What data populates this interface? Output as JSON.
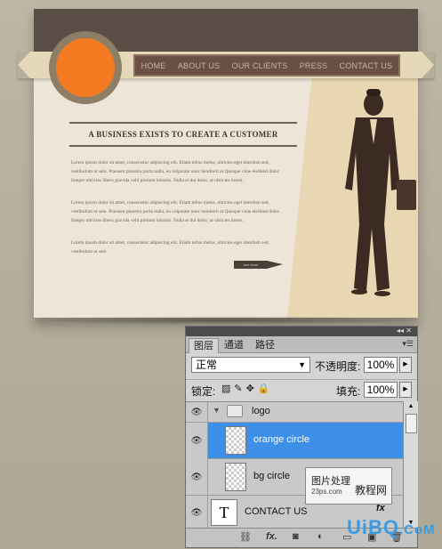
{
  "site": {
    "nav": [
      "HOME",
      "ABOUT US",
      "OUR CLIENTS",
      "PRESS",
      "CONTACT US"
    ],
    "headline": "A BUSINESS EXISTS TO CREATE A CUSTOMER",
    "paragraphs": [
      "Lorem ipsum dolor sit amet, consectetur adipiscing elit. Etiam tellus metus, ultricies eget interdum sed, vestibulum ut sem. Praesent pharetra porta nulla, eu vulputate nunc hendrerit at Quisque vitae eleifend dolor. Integer ultricies libero gravida velit pretium lobortis. Nulla et dui dolor, ut ultricies lorem.",
      "Lorem ipsum dolor sit amet, consectetur adipiscing elit. Etiam tellus metus, ultricies eget interdum sed, vestibulum ut sem. Praesent pharetra porta nulla, eu vulputate nunc hendrerit at Quisque vitae eleifend dolor. Integer ultricies libero gravida velit pretium lobortis. Nulla et dui dolor, ut ultricies lorem.",
      "Lorem ipsum dolor sit amet, consectetur adipiscing elit. Etiam tellus metus, ultricies eget interdum sed, vestibulum ut sem."
    ],
    "cta_label": "see more",
    "colors": {
      "logo_orange": "#f47a21",
      "nav_bg": "#6a4f44",
      "header_bg": "#5a4e47"
    }
  },
  "layers_panel": {
    "tabs": [
      "图层",
      "通道",
      "路径"
    ],
    "blend_mode": "正常",
    "opacity_label": "不透明度:",
    "opacity_value": "100%",
    "lock_label": "锁定:",
    "fill_label": "填充:",
    "fill_value": "100%",
    "layers": [
      {
        "name": "logo",
        "type": "group"
      },
      {
        "name": "orange circle",
        "type": "layer",
        "selected": true
      },
      {
        "name": "bg circle",
        "type": "layer"
      },
      {
        "name": "CONTACT US",
        "type": "text",
        "thumb_glyph": "T"
      }
    ],
    "footer_icons": [
      "link-icon",
      "fx-icon",
      "mask-icon",
      "adjustment-icon",
      "folder-icon",
      "new-layer-icon",
      "trash-icon"
    ]
  },
  "watermark": {
    "line1": "图片处理",
    "line2": "23ps.com",
    "line3": "教程网",
    "brand": "UiBQ",
    "brand_suffix": ".CoM"
  }
}
